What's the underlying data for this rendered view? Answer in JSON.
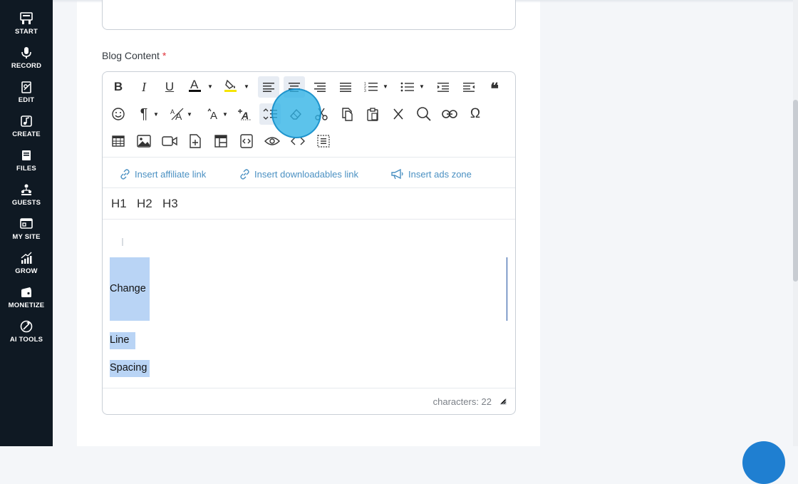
{
  "sidebar": {
    "items": [
      {
        "label": "START",
        "icon": "start-icon"
      },
      {
        "label": "RECORD",
        "icon": "microphone-icon"
      },
      {
        "label": "EDIT",
        "icon": "edit-icon"
      },
      {
        "label": "CREATE",
        "icon": "create-icon"
      },
      {
        "label": "FILES",
        "icon": "files-icon"
      },
      {
        "label": "GUESTS",
        "icon": "guests-icon"
      },
      {
        "label": "MY SITE",
        "icon": "my-site-icon"
      },
      {
        "label": "GROW",
        "icon": "grow-icon"
      },
      {
        "label": "MONETIZE",
        "icon": "monetize-icon"
      },
      {
        "label": "AI TOOLS",
        "icon": "ai-tools-icon"
      }
    ]
  },
  "form": {
    "field_label": "Blog Content",
    "required_mark": "*"
  },
  "toolbar": {
    "row1": [
      "bold",
      "italic",
      "underline",
      "font-color",
      "highlight-color",
      "align-left",
      "align-center",
      "align-right",
      "align-justify",
      "ordered-list",
      "unordered-list",
      "indent",
      "outdent",
      "blockquote"
    ],
    "row2": [
      "emoticons",
      "paragraph-format",
      "font-size",
      "letter-case",
      "text-style",
      "line-spacing",
      "clear-formatting",
      "cut",
      "copy",
      "paste",
      "strikethrough",
      "find",
      "link",
      "special-characters"
    ],
    "row3": [
      "table",
      "image",
      "video",
      "insert-file",
      "insert-template",
      "embed-code",
      "preview",
      "code-view",
      "select-all"
    ],
    "icons": {
      "bold": "B",
      "italic": "I",
      "underline": "U",
      "font_color": "A",
      "paragraph": "¶",
      "omega": "Ω",
      "quote": "❝"
    },
    "font_color_swatch": "#111111",
    "highlight_swatch": "#f5e400"
  },
  "plugins": {
    "affiliate": "Insert affiliate link",
    "downloadables": "Insert downloadables link",
    "ads": "Insert ads zone"
  },
  "headings": {
    "h1": "H1",
    "h2": "H2",
    "h3": "H3"
  },
  "editor_body": {
    "line1": "Change",
    "line2": "Line",
    "line3": "Spacing"
  },
  "status": {
    "characters": "characters: 22"
  },
  "colors": {
    "sidebar_bg": "#0f1923",
    "link": "#4a90c2",
    "selection": "#b9d4f5",
    "highlight_circle": "#2eb2e6",
    "required": "#e0333a"
  }
}
